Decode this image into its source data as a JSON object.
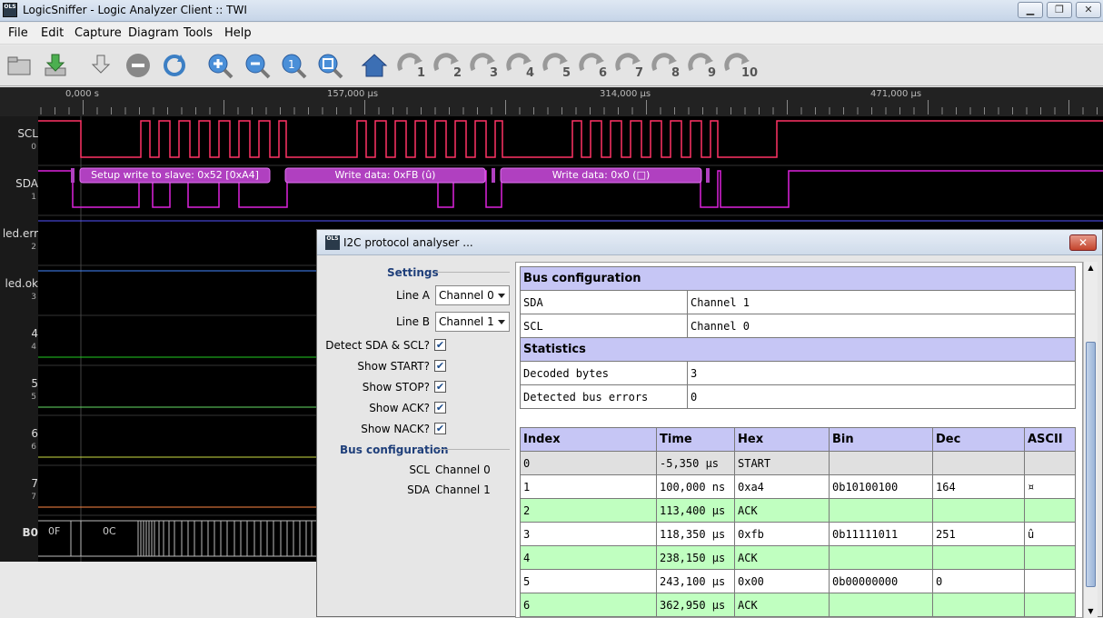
{
  "window": {
    "title": "LogicSniffer - Logic Analyzer Client :: TWI",
    "icon_text": "OLS"
  },
  "menu": [
    "File",
    "Edit",
    "Capture",
    "Diagram",
    "Tools",
    "Help"
  ],
  "toolbar": {
    "icons": [
      "open-icon",
      "save-download-icon",
      "capture-icon",
      "stop-icon",
      "refresh-icon",
      "zoom-in-icon",
      "zoom-out-icon",
      "zoom-original-icon",
      "zoom-all-icon",
      "home-icon"
    ],
    "markers": [
      "1",
      "2",
      "3",
      "4",
      "5",
      "6",
      "7",
      "8",
      "9",
      "10"
    ]
  },
  "ruler": {
    "labels": [
      "0,000 s",
      "157,000 µs",
      "314,000 µs",
      "471,000 µs"
    ]
  },
  "channels": [
    {
      "name": "SCL",
      "index": "0"
    },
    {
      "name": "SDA",
      "index": "1"
    },
    {
      "name": "led.err",
      "index": "2"
    },
    {
      "name": "led.ok",
      "index": "3"
    },
    {
      "name": "4",
      "index": "4"
    },
    {
      "name": "5",
      "index": "5"
    },
    {
      "name": "6",
      "index": "6"
    },
    {
      "name": "7",
      "index": "7"
    }
  ],
  "group": {
    "name": "B0",
    "values": [
      "0F",
      "0C"
    ]
  },
  "annotations": [
    "Setup write to slave: 0x52 [0xA4]",
    "Write data: 0xFB (û)",
    "Write data: 0x0 (□)"
  ],
  "colors": {
    "scl": "#ff3366",
    "sda": "#dd22dd",
    "annotation": "#b040c0",
    "header": "#c6c6f5",
    "ack_row": "#c0ffc0",
    "start_row": "#e0e0e0"
  },
  "dialog": {
    "title": "I2C protocol analyser ...",
    "icon_text": "OLS",
    "settings": {
      "heading": "Settings",
      "line_a_label": "Line A",
      "line_a_value": "Channel 0",
      "line_b_label": "Line B",
      "line_b_value": "Channel 1",
      "checks": [
        {
          "label": "Detect SDA & SCL?",
          "checked": true
        },
        {
          "label": "Show START?",
          "checked": true
        },
        {
          "label": "Show STOP?",
          "checked": true
        },
        {
          "label": "Show ACK?",
          "checked": true
        },
        {
          "label": "Show NACK?",
          "checked": true
        }
      ]
    },
    "bus_config": {
      "heading": "Bus configuration",
      "scl_label": "SCL",
      "scl_value": "Channel 0",
      "sda_label": "SDA",
      "sda_value": "Channel 1"
    },
    "summary": {
      "bus_heading": "Bus configuration",
      "sda_label": "SDA",
      "sda_value": "Channel 1",
      "scl_label": "SCL",
      "scl_value": "Channel 0",
      "stats_heading": "Statistics",
      "decoded_label": "Decoded bytes",
      "decoded_value": "3",
      "errors_label": "Detected bus errors",
      "errors_value": "0"
    },
    "table": {
      "columns": [
        "Index",
        "Time",
        "Hex",
        "Bin",
        "Dec",
        "ASCII"
      ],
      "rows": [
        {
          "style": "gray",
          "cells": [
            "0",
            "-5,350 µs",
            "START",
            "",
            "",
            ""
          ]
        },
        {
          "style": "white",
          "cells": [
            "1",
            "100,000 ns",
            "0xa4",
            "0b10100100",
            "164",
            "¤"
          ]
        },
        {
          "style": "green",
          "cells": [
            "2",
            "113,400 µs",
            "ACK",
            "",
            "",
            ""
          ]
        },
        {
          "style": "white",
          "cells": [
            "3",
            "118,350 µs",
            "0xfb",
            "0b11111011",
            "251",
            "û"
          ]
        },
        {
          "style": "green",
          "cells": [
            "4",
            "238,150 µs",
            "ACK",
            "",
            "",
            ""
          ]
        },
        {
          "style": "white",
          "cells": [
            "5",
            "243,100 µs",
            "0x00",
            "0b00000000",
            "0",
            ""
          ]
        },
        {
          "style": "green",
          "cells": [
            "6",
            "362,950 µs",
            "ACK",
            "",
            "",
            ""
          ]
        }
      ]
    }
  }
}
